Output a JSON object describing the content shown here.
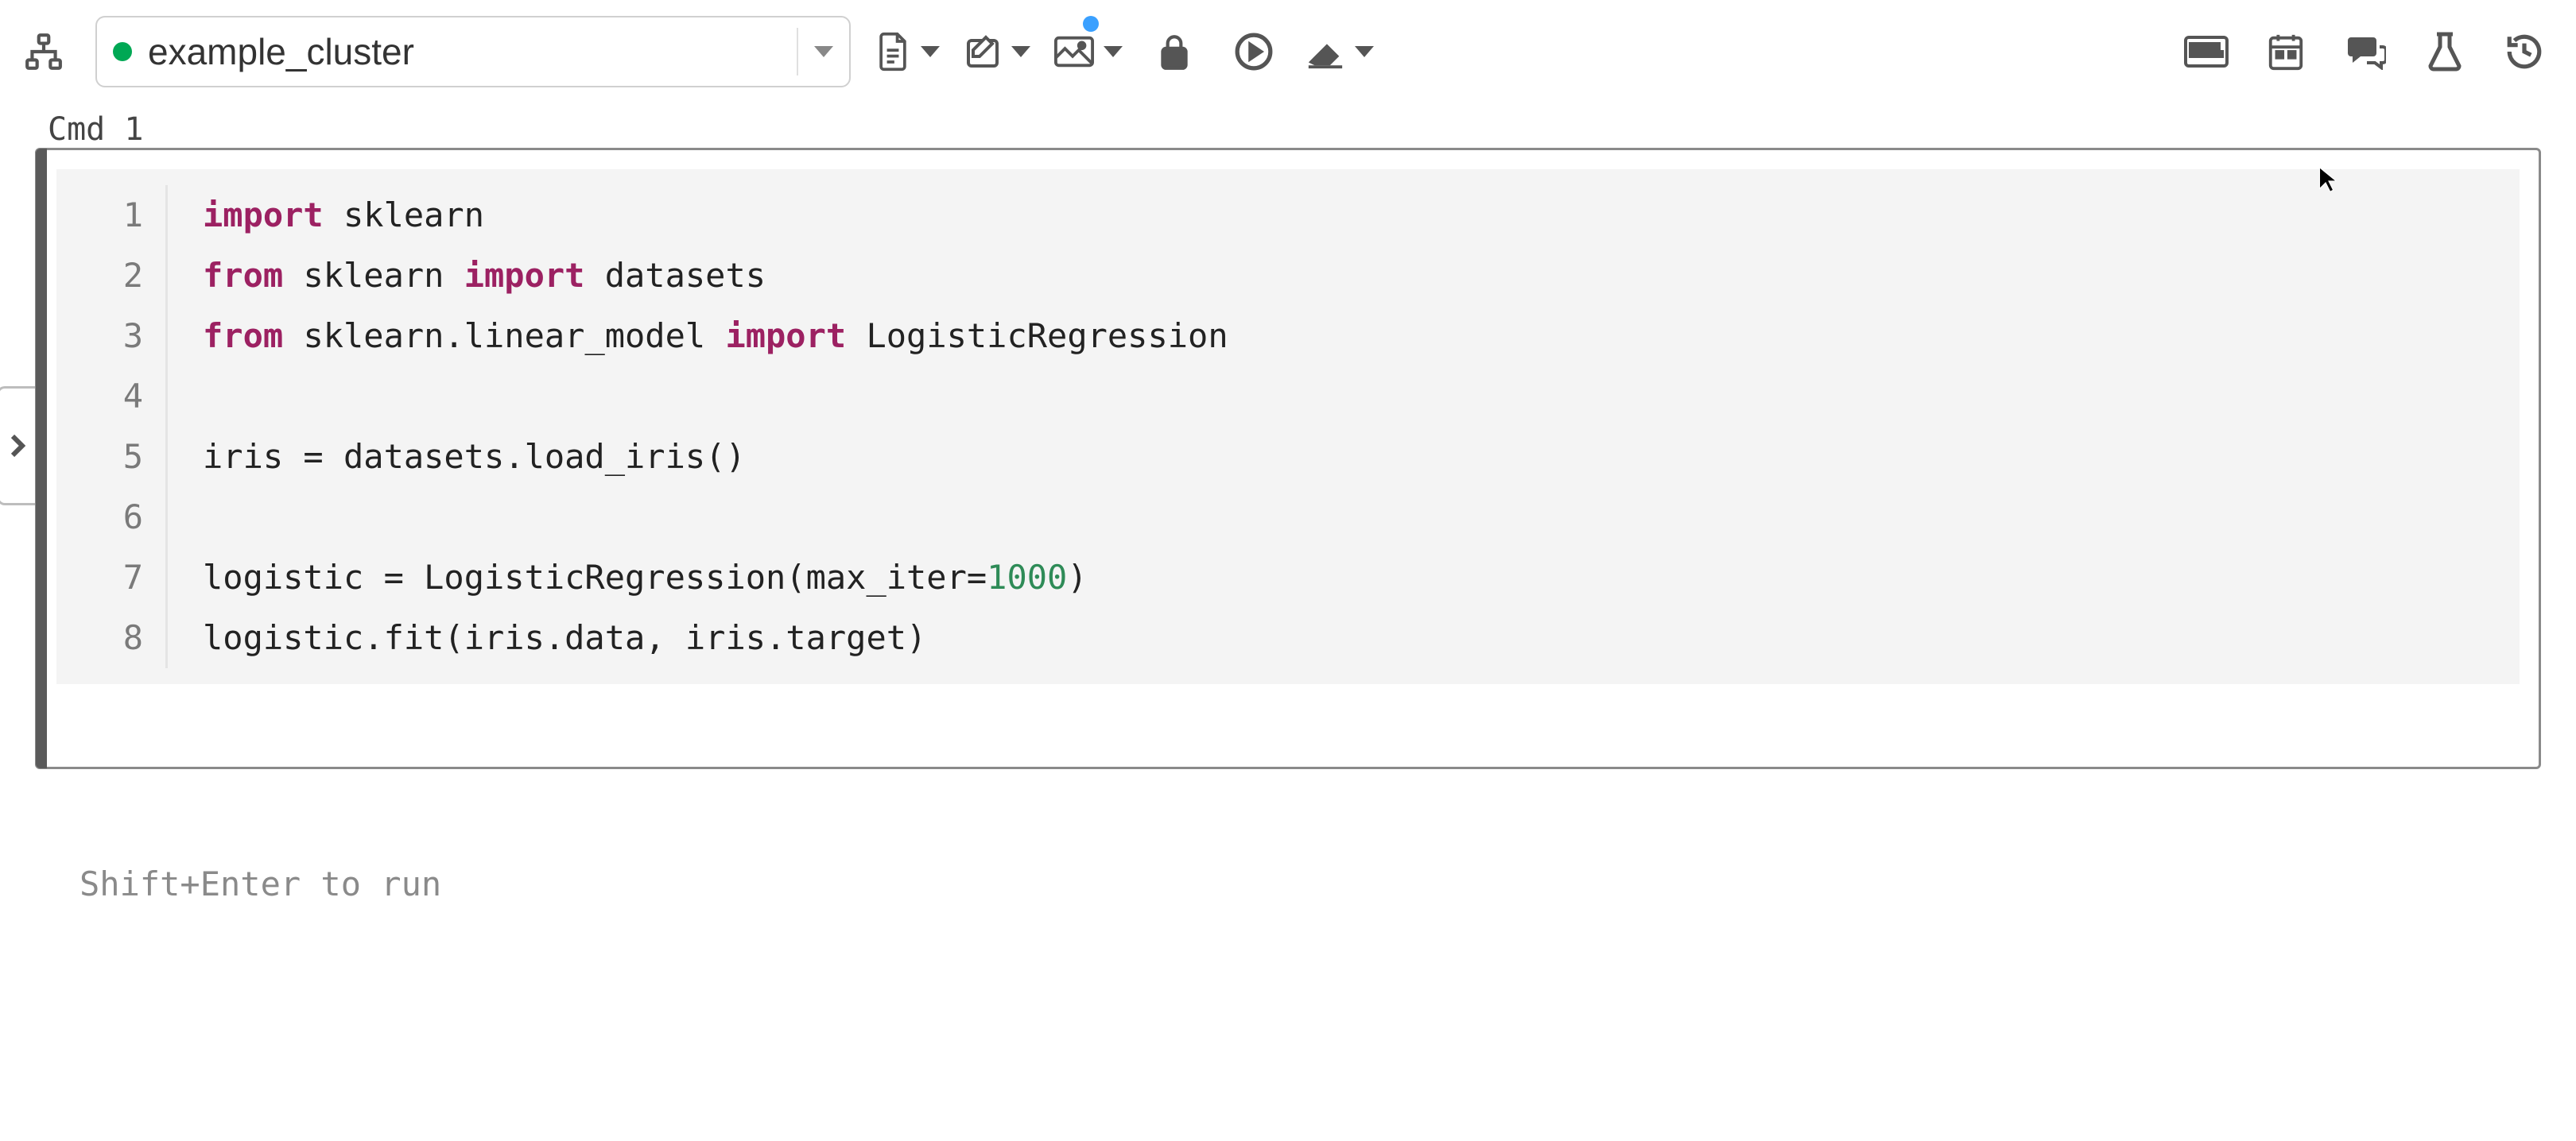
{
  "toolbar": {
    "cluster_name": "example_cluster",
    "cluster_status": "running",
    "icons": {
      "tree": "tree-icon",
      "file": "file-icon",
      "edit": "edit-icon",
      "image": "image-icon",
      "lock": "lock-icon",
      "run_all": "run-all-icon",
      "clear": "clear-icon",
      "keyboard": "keyboard-icon",
      "schedule": "schedule-icon",
      "comments": "comments-icon",
      "experiments": "experiments-icon",
      "history": "history-icon"
    }
  },
  "cell": {
    "label": "Cmd 1",
    "actions": {
      "run": "run-cell",
      "move_down": "move-down",
      "minimize": "minimize",
      "delete": "delete"
    },
    "code_lines": [
      {
        "n": 1,
        "tokens": [
          {
            "t": "import",
            "c": "kw"
          },
          {
            "t": " sklearn",
            "c": "plain"
          }
        ]
      },
      {
        "n": 2,
        "tokens": [
          {
            "t": "from",
            "c": "kw"
          },
          {
            "t": " sklearn ",
            "c": "plain"
          },
          {
            "t": "import",
            "c": "kw"
          },
          {
            "t": " datasets",
            "c": "plain"
          }
        ]
      },
      {
        "n": 3,
        "tokens": [
          {
            "t": "from",
            "c": "kw"
          },
          {
            "t": " sklearn.linear_model ",
            "c": "plain"
          },
          {
            "t": "import",
            "c": "kw"
          },
          {
            "t": " LogisticRegression",
            "c": "plain"
          }
        ]
      },
      {
        "n": 4,
        "tokens": []
      },
      {
        "n": 5,
        "tokens": [
          {
            "t": "iris = datasets.load_iris()",
            "c": "plain"
          }
        ]
      },
      {
        "n": 6,
        "tokens": []
      },
      {
        "n": 7,
        "tokens": [
          {
            "t": "logistic = LogisticRegression(max_iter=",
            "c": "plain"
          },
          {
            "t": "1000",
            "c": "num"
          },
          {
            "t": ")",
            "c": "plain"
          }
        ]
      },
      {
        "n": 8,
        "tokens": [
          {
            "t": "logistic.fit(iris.data, iris.target)",
            "c": "plain"
          }
        ]
      }
    ]
  },
  "hint": "Shift+Enter to run"
}
